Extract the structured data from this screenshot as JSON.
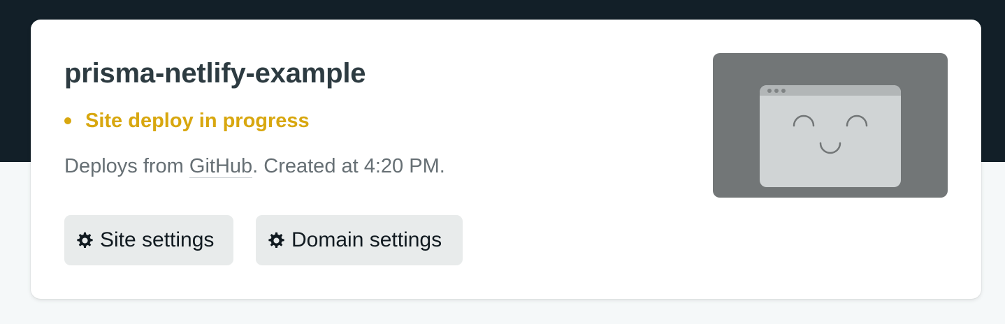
{
  "site": {
    "name": "prisma-netlify-example",
    "status": "Site deploy in progress",
    "status_color": "#d8a70f",
    "deploy_prefix": "Deploys from ",
    "deploy_source": "GitHub",
    "created_text": ". Created at 4:20 PM."
  },
  "actions": {
    "site_settings_label": "Site settings",
    "domain_settings_label": "Domain settings",
    "icon": "gear-icon"
  },
  "preview": {
    "icon": "smiling-browser-window-illustration"
  },
  "colors": {
    "header_band": "#121f28",
    "page_background": "#f5f8f9",
    "card": "#ffffff",
    "title": "#2d3b41",
    "button": "#e8ebeb"
  }
}
